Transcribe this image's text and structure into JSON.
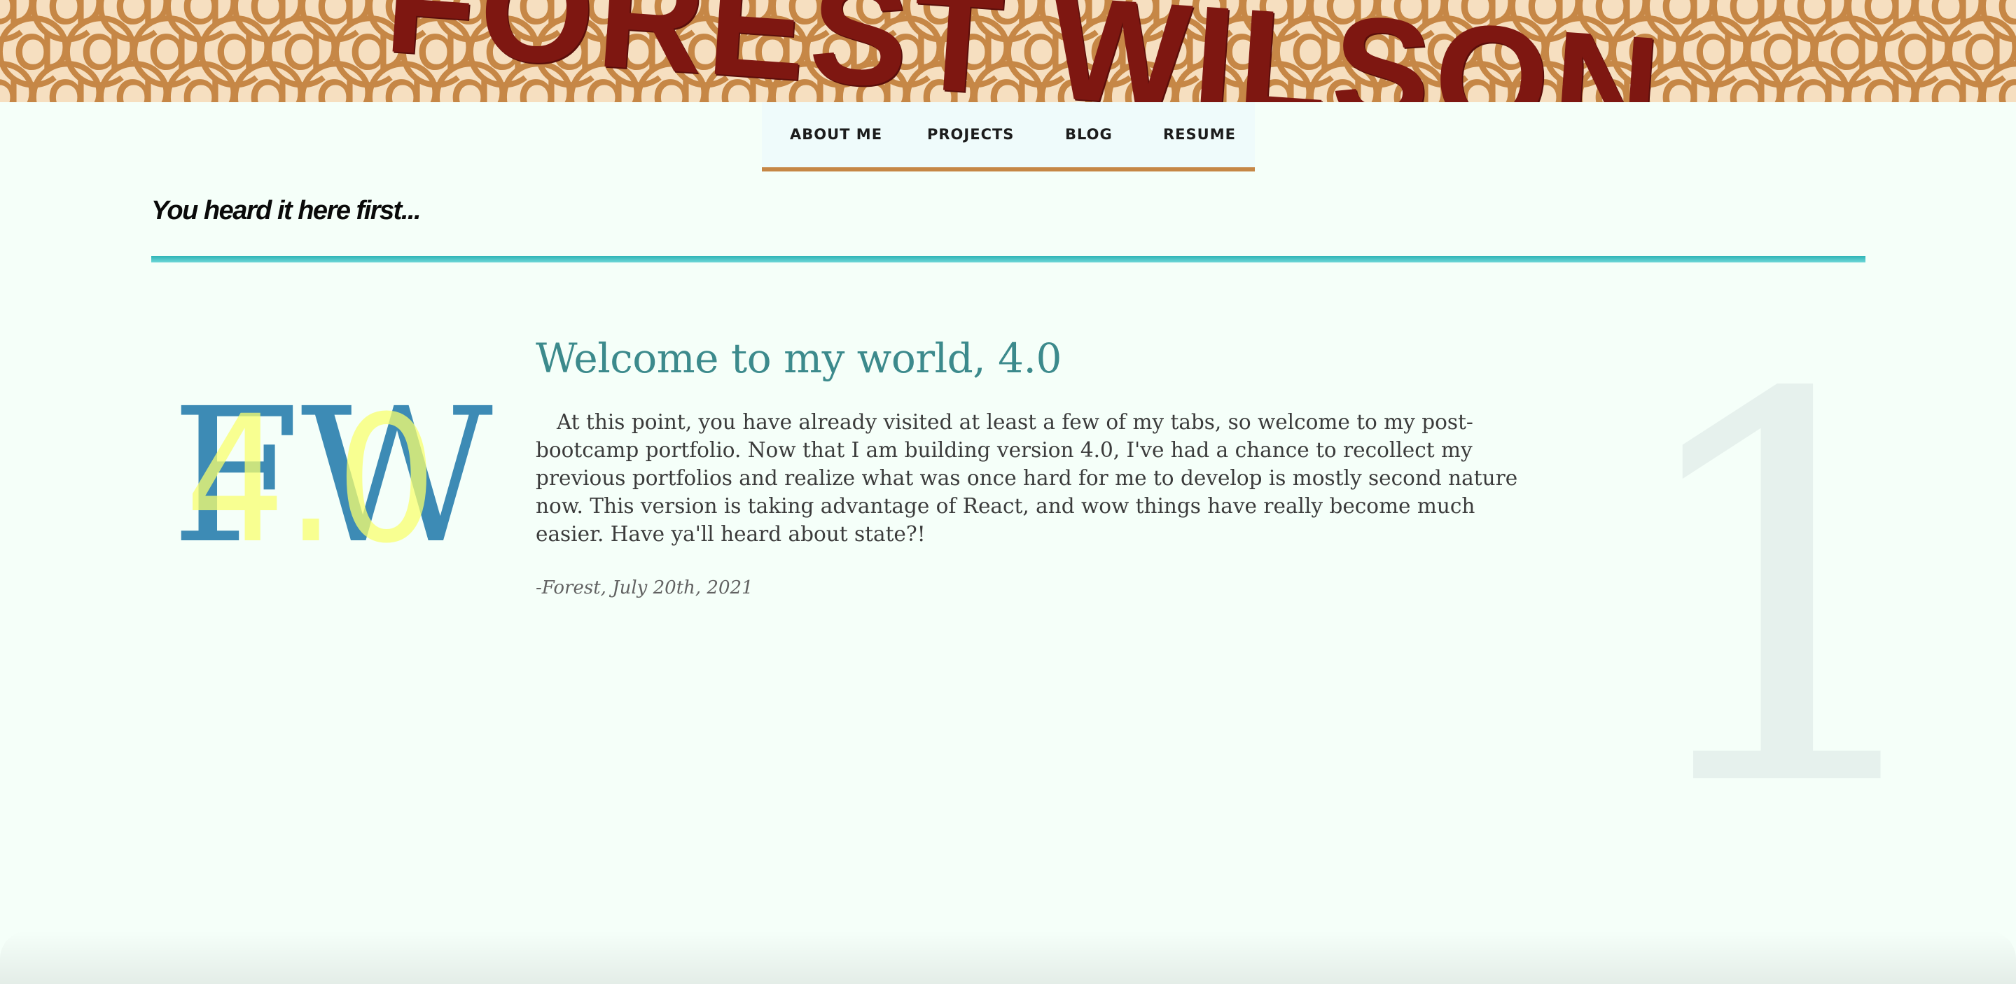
{
  "banner": {
    "name": "FOREST WILSON",
    "pattern_glyph": "@",
    "colors": {
      "pattern": "#c68746",
      "background": "#f6dfc0",
      "name": "#7e1711"
    }
  },
  "nav": {
    "items": [
      {
        "label": "ABOUT ME"
      },
      {
        "label": "PROJECTS"
      },
      {
        "label": "BLOG"
      },
      {
        "label": "RESUME"
      }
    ],
    "underline_color": "#c68746"
  },
  "blog": {
    "tagline": "You heard it here first...",
    "divider_color": "#2fb5b7"
  },
  "post": {
    "logo": {
      "letters": "FW",
      "version": "4.0",
      "colors": {
        "letters": "#3d8bb5",
        "version": "#f8ff6e"
      }
    },
    "title": "Welcome to my world, 4.0",
    "body": "At this point, you have already visited at least a few of my tabs, so welcome to my post-bootcamp portfolio. Now that I am building version 4.0, I've had a chance to recollect my previous portfolios and realize what was once hard for me to develop is mostly second nature now. This version is taking advantage of React, and wow things have really become much easier. Have ya'll heard about state?!",
    "signature": "-Forest, July 20th, 2021",
    "number": "1",
    "title_color": "#3c8a8c"
  }
}
